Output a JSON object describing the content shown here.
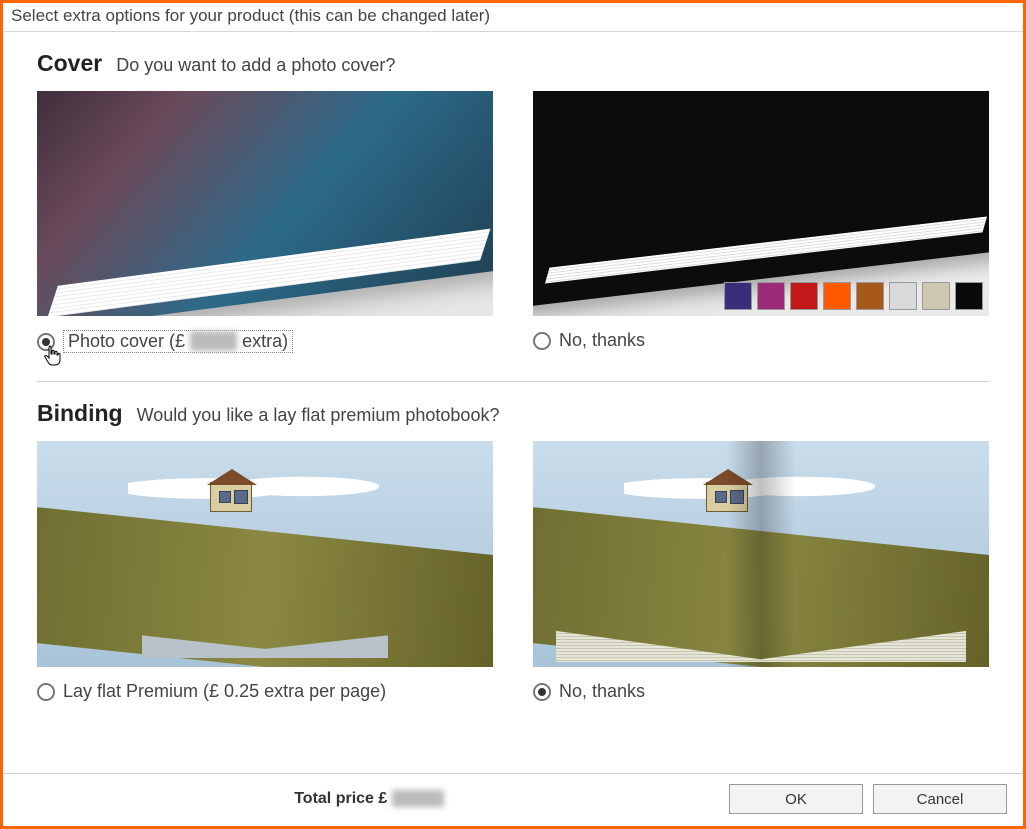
{
  "window_title": "Select extra options for your product (this can be changed later)",
  "cover": {
    "title": "Cover",
    "question": "Do you want to add a photo cover?",
    "option_photo_prefix": "Photo cover (£ ",
    "option_photo_suffix": " extra)",
    "option_no": "No, thanks",
    "swatches": [
      "#3b2d7a",
      "#9c2b78",
      "#c2181a",
      "#ff5a00",
      "#a65a1a",
      "#d9d9d9",
      "#cfc8b0",
      "#0a0a0a"
    ]
  },
  "binding": {
    "title": "Binding",
    "question": "Would you like a lay flat premium photobook?",
    "option_layflat": "Lay flat Premium (£ 0.25 extra per page)",
    "option_no": "No, thanks"
  },
  "footer": {
    "total_label": "Total price £ ",
    "ok": "OK",
    "cancel": "Cancel"
  }
}
